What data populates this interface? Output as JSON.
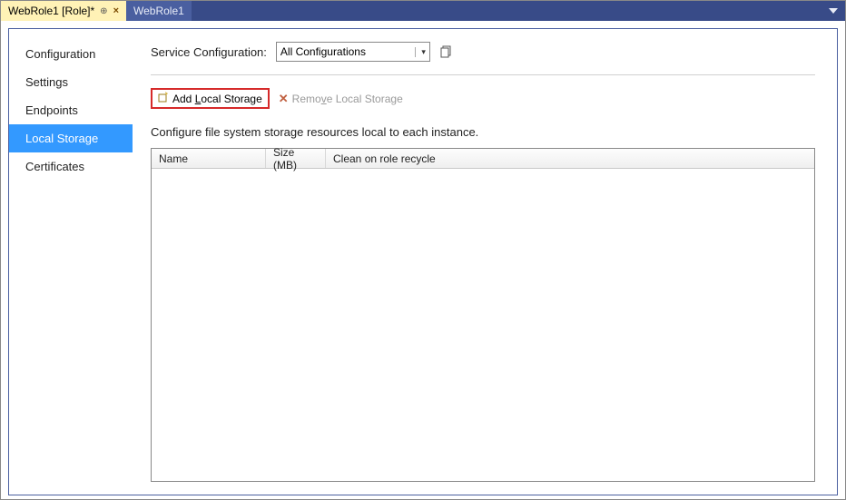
{
  "tabs": {
    "active": "WebRole1 [Role]*",
    "inactive": "WebRole1"
  },
  "sidebar": {
    "items": [
      {
        "label": "Configuration",
        "selected": false
      },
      {
        "label": "Settings",
        "selected": false
      },
      {
        "label": "Endpoints",
        "selected": false
      },
      {
        "label": "Local Storage",
        "selected": true
      },
      {
        "label": "Certificates",
        "selected": false
      }
    ]
  },
  "config": {
    "label": "Service Configuration:",
    "selected": "All Configurations"
  },
  "toolbar": {
    "add_prefix": "Add ",
    "add_key": "L",
    "add_suffix": "ocal Storage",
    "remove_prefix": "Remo",
    "remove_key": "v",
    "remove_suffix": "e Local Storage"
  },
  "description": "Configure file system storage resources local to each instance.",
  "grid": {
    "columns": {
      "name": "Name",
      "size": "Size (MB)",
      "clean": "Clean on role recycle"
    },
    "rows": []
  }
}
